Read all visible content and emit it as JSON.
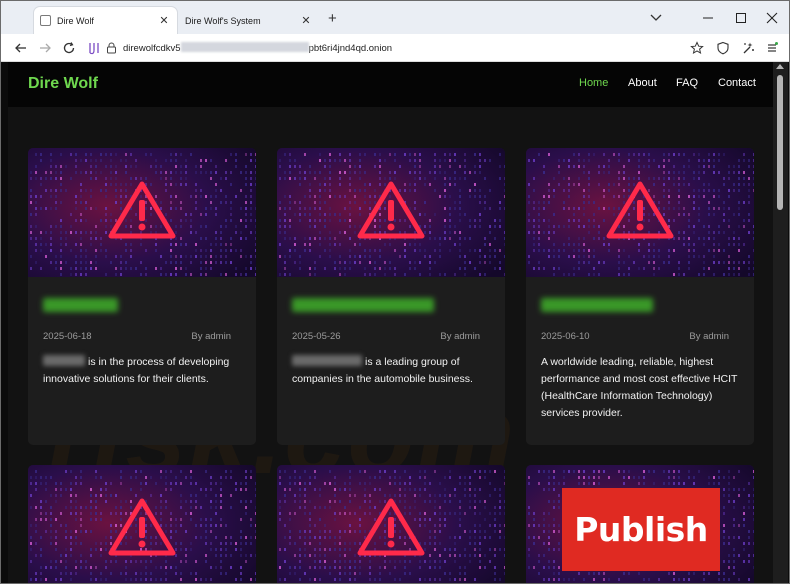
{
  "browser": {
    "tabs": [
      {
        "title": "Dire Wolf",
        "active": true
      },
      {
        "title": "Dire Wolf's System",
        "active": false
      }
    ],
    "url_prefix": "direwolfcdkv5",
    "url_suffix": "pbt6ri4jnd4qd.onion",
    "icons": [
      "back-icon",
      "forward-icon",
      "reload-icon",
      "tor-circuit-icon",
      "lock-icon",
      "star-icon",
      "shield-icon",
      "security-level-icon",
      "menu-icon"
    ]
  },
  "site": {
    "brand": "Dire Wolf",
    "nav": [
      "Home",
      "About",
      "FAQ",
      "Contact"
    ],
    "active_nav": "Home",
    "watermark": "risk.com"
  },
  "cards": [
    {
      "date": "2025-06-18",
      "author": "By admin",
      "desc": "is in the process of developing innovative solutions for their clients."
    },
    {
      "date": "2025-05-26",
      "author": "By admin",
      "desc": "is a leading group of companies in the automobile business."
    },
    {
      "date": "2025-06-10",
      "author": "By admin",
      "desc": "A worldwide leading, reliable, highest performance and most cost effective HCIT (HealthCare Information Technology) services provider."
    }
  ],
  "publish_label": "Publish",
  "colors": {
    "brand_green": "#6fd84f",
    "warning_red": "#ff2a4a",
    "publish_red": "#e02a22",
    "page_bg": "#121212"
  }
}
